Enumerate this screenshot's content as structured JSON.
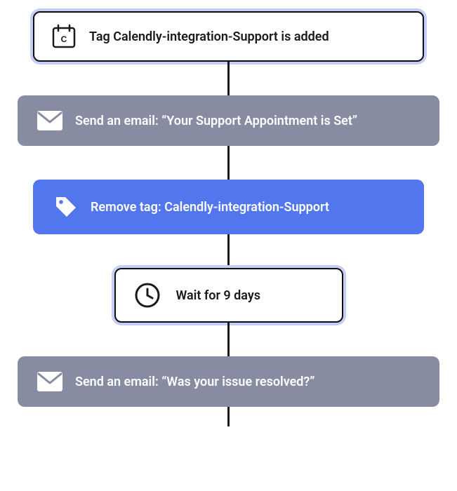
{
  "flow": {
    "nodes": [
      {
        "type": "trigger",
        "icon": "calendar",
        "text": "Tag Calendly-integration-Support is added"
      },
      {
        "type": "email",
        "icon": "email",
        "text": "Send an email: “Your Support Appointment is Set”"
      },
      {
        "type": "remove-tag",
        "icon": "tag",
        "text": "Remove tag: Calendly-integration-Support"
      },
      {
        "type": "wait",
        "icon": "clock",
        "text": "Wait for 9 days"
      },
      {
        "type": "email",
        "icon": "email",
        "text": "Send an email: “Was your issue resolved?”"
      }
    ]
  },
  "colors": {
    "dark": "#1a1a1a",
    "gray": "#888ca3",
    "blue": "#5176ed",
    "highlight": "#c6cdf7",
    "white": "#ffffff"
  }
}
